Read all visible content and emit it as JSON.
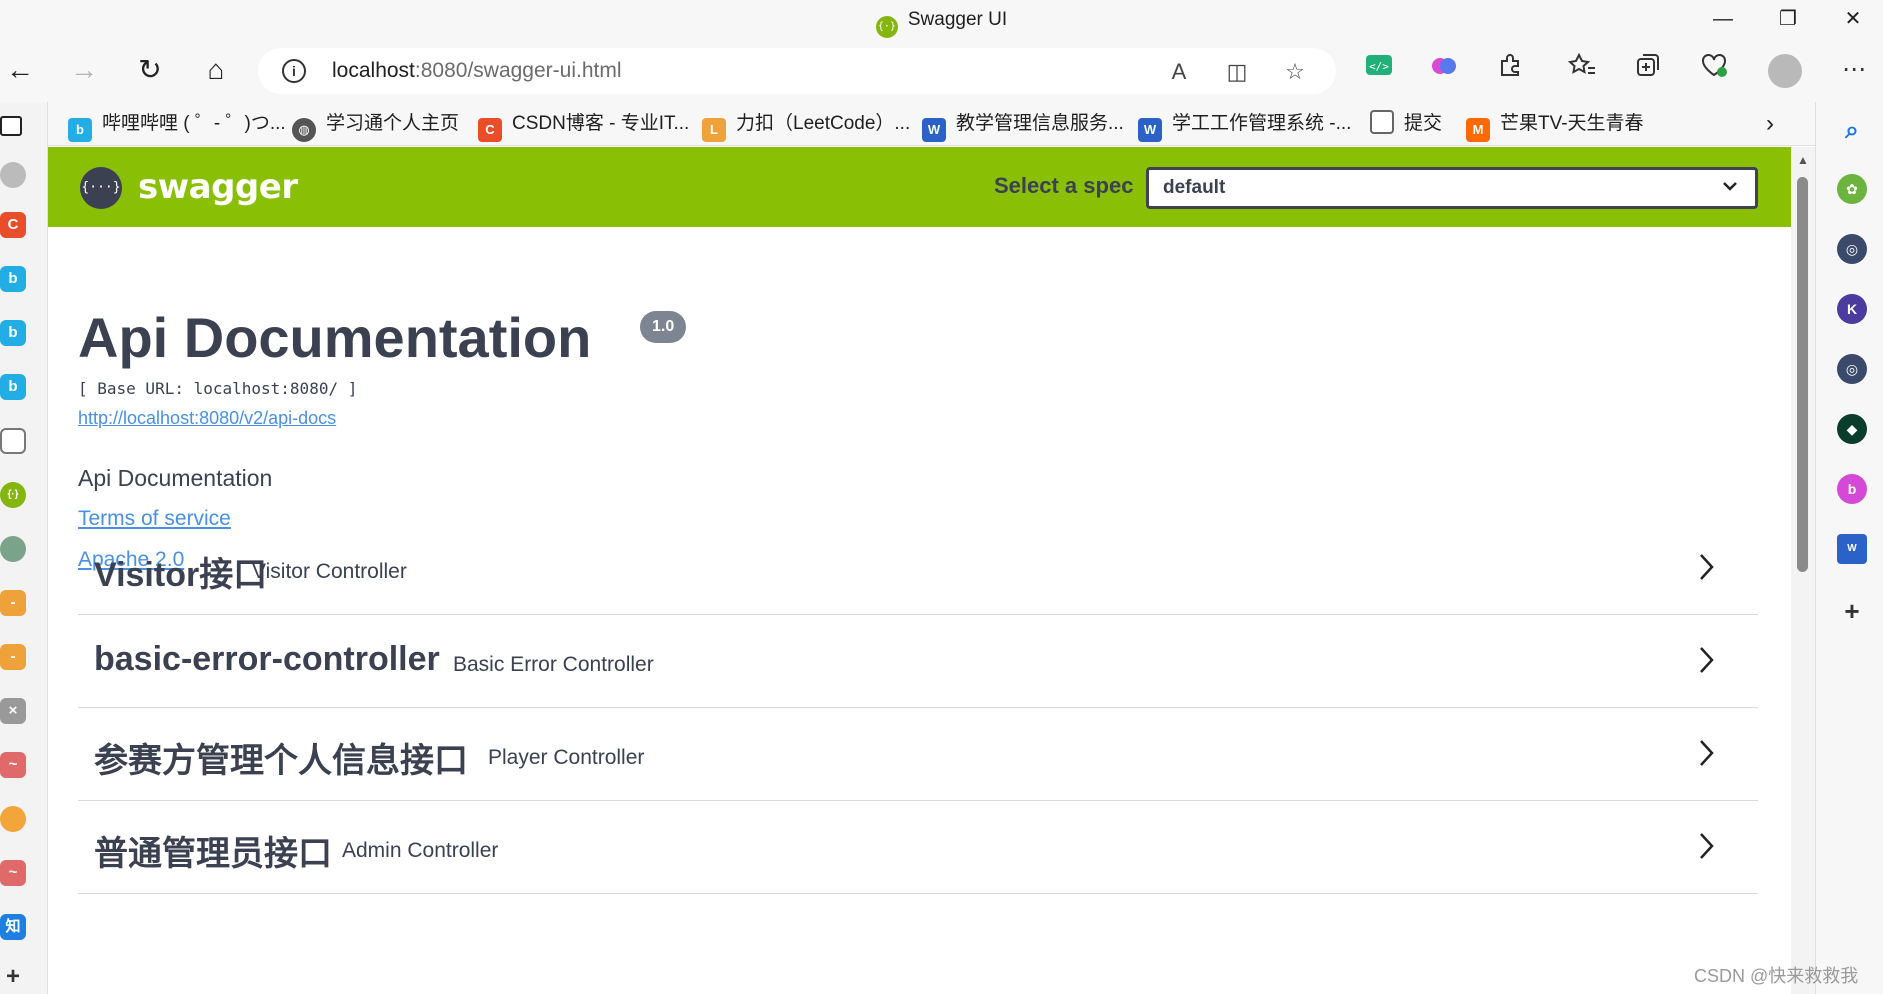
{
  "window": {
    "title": "Swagger UI",
    "minimize": "—",
    "restore": "❐",
    "close": "✕"
  },
  "browser": {
    "back": "←",
    "forward": "→",
    "reload": "↻",
    "home": "⌂",
    "url_host": "localhost",
    "url_rest": ":8080/swagger-ui.html",
    "info_icon": "i",
    "read_aloud": "A",
    "split": "◫",
    "favorite": "☆",
    "more": "⋯"
  },
  "bookmarks": [
    {
      "label": "哔哩哔哩 ( ゜- ゜)つ...",
      "color": "#23ade5",
      "icon": "bilibili-icon"
    },
    {
      "label": "学习通个人主页",
      "color": "#555555",
      "icon": "globe-icon"
    },
    {
      "label": "CSDN博客 - 专业IT...",
      "color": "#e94e2a",
      "icon": "csdn-icon"
    },
    {
      "label": "力扣（LeetCode）...",
      "color": "#f0a23a",
      "icon": "leetcode-icon"
    },
    {
      "label": "教学管理信息服务...",
      "color": "#2b62c7",
      "icon": "school-icon"
    },
    {
      "label": "学工工作管理系统 -...",
      "color": "#2b62c7",
      "icon": "school-icon"
    },
    {
      "label": "提交",
      "color": "#666666",
      "icon": "page-icon"
    },
    {
      "label": "芒果TV-天生青春",
      "color": "#ff6a00",
      "icon": "mangotv-icon"
    }
  ],
  "swagger": {
    "brand": "swagger",
    "logo_glyph": "{···}",
    "select_label": "Select a spec",
    "select_value": "default",
    "chevron": "⌄"
  },
  "info": {
    "title": "Api Documentation",
    "version": "1.0",
    "base_url": "[ Base URL: localhost:8080/ ]",
    "api_docs_link": "http://localhost:8080/v2/api-docs",
    "description": "Api Documentation",
    "terms": "Terms of service",
    "license": "Apache 2.0"
  },
  "tags": [
    {
      "name": "Visitor接口",
      "description": "Visitor Controller"
    },
    {
      "name": "basic-error-controller",
      "description": "Basic Error Controller"
    },
    {
      "name": "参赛方管理个人信息接口",
      "description": "Player Controller"
    },
    {
      "name": "普通管理员接口",
      "description": "Admin Controller"
    }
  ],
  "watermark": "CSDN @快来救救我",
  "colors": {
    "swagger_green": "#89bf04",
    "swagger_text": "#3b4151",
    "link": "#4990e2"
  }
}
